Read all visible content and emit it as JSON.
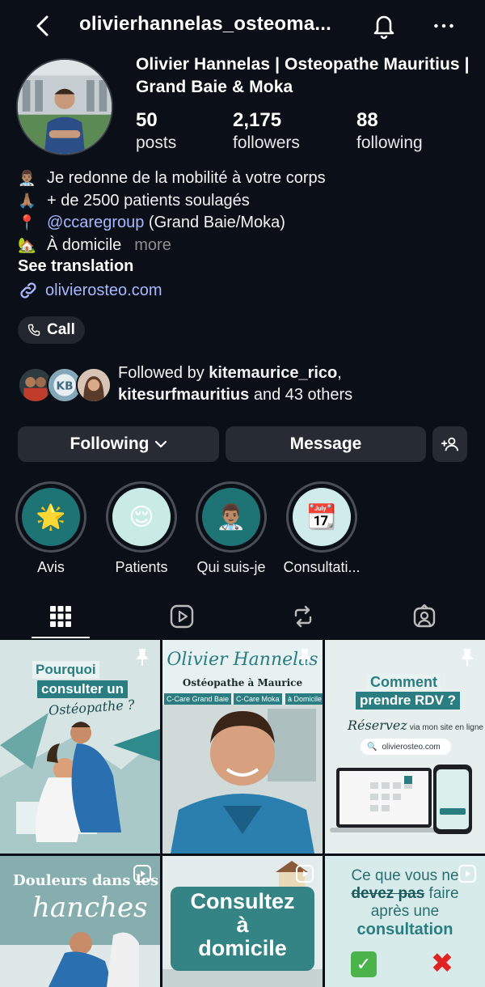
{
  "header": {
    "username": "olivierhannelas_osteoma...",
    "icons": [
      "back-arrow-icon",
      "bell-icon",
      "more-options-icon"
    ]
  },
  "profile": {
    "display_name": "Olivier Hannelas | Osteopathe Mauritius | Grand Baie & Moka",
    "stats": [
      {
        "value": "50",
        "label": "posts"
      },
      {
        "value": "2,175",
        "label": "followers"
      },
      {
        "value": "88",
        "label": "following"
      }
    ],
    "bio": {
      "line1": "Je redonne de la mobilité à votre corps",
      "line2": "+ de 2500 patients soulagés",
      "line3_mention": "@ccaregroup",
      "line3_rest": " (Grand Baie/Moka)",
      "line4": "À domicile",
      "more": "more"
    },
    "see_translation": "See translation",
    "website": "olivierosteo.com",
    "call_label": "Call"
  },
  "followed_by": {
    "prefix": "Followed by ",
    "user1": "kitemaurice_rico",
    "sep": ",",
    "user2": "kitesurfmauritius",
    "suffix": " and 43 others"
  },
  "actions": {
    "following": "Following",
    "message": "Message"
  },
  "highlights": [
    {
      "name": "Avis",
      "emoji": "🌟"
    },
    {
      "name": "Patients",
      "emoji": "😌"
    },
    {
      "name": "Qui suis-je",
      "emoji": "👨🏽‍⚕️"
    },
    {
      "name": "Consultati...",
      "emoji": "📆"
    }
  ],
  "tabs": [
    "grid-icon",
    "reels-icon",
    "reposts-icon",
    "tagged-icon"
  ],
  "posts": {
    "p1": {
      "line1": "Pourquoi",
      "line2": "consulter un",
      "script": "Ostéopathe ?"
    },
    "p2": {
      "script": "Olivier Hannelas",
      "subtitle": "Ostéopathe à Maurice",
      "tags": [
        "C-Care Grand Baie",
        "C-Care Moka",
        "à Domicile"
      ]
    },
    "p3": {
      "title1": "Comment",
      "title2": "prendre RDV ?",
      "script": "Réservez",
      "small": "via mon site en ligne",
      "url": "olivierosteo.com"
    },
    "p4": {
      "line1": "Douleurs dans les",
      "script": "hanches"
    },
    "p5": {
      "line1": "Consultez",
      "line2": "à",
      "line3": "domicile"
    },
    "p6": {
      "line1": "Ce que vous ne",
      "line2_strike": "devez pas",
      "line2_rest": " faire",
      "line3": "après une",
      "line4": "consultation",
      "yes": "✅",
      "no": "✖"
    }
  },
  "colors": {
    "background": "#0b0f17",
    "button": "#272b33",
    "link": "#a8b8ff",
    "teal": "#2a7d80"
  }
}
